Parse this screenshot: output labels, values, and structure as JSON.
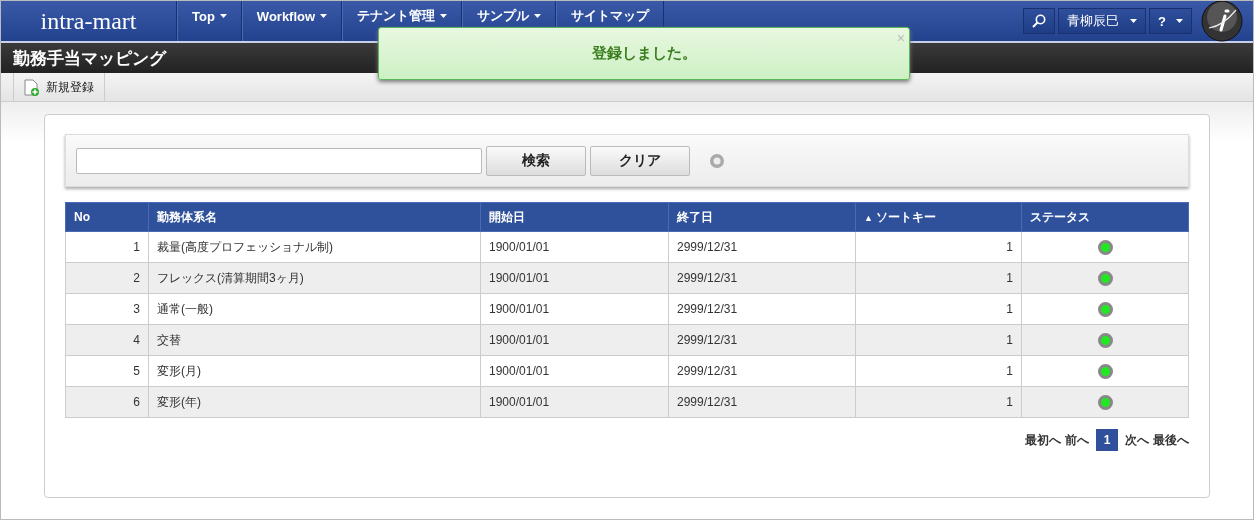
{
  "header": {
    "logo": "intra-mart",
    "nav": [
      {
        "label": "Top",
        "dropdown": true
      },
      {
        "label": "Workflow",
        "dropdown": true
      },
      {
        "label": "テナント管理",
        "dropdown": true
      },
      {
        "label": "サンプル",
        "dropdown": true
      },
      {
        "label": "サイトマップ",
        "dropdown": false
      }
    ],
    "user": "青柳辰巳",
    "help": "?"
  },
  "page_title": "勤務手当マッピング",
  "toolbar": [
    {
      "label": "新規登録"
    }
  ],
  "toast": {
    "message": "登録しました。",
    "close": "×"
  },
  "search": {
    "buttons": [
      "検索",
      "クリア"
    ]
  },
  "table": {
    "columns": [
      {
        "label": "No"
      },
      {
        "label": "勤務体系名"
      },
      {
        "label": "開始日"
      },
      {
        "label": "終了日"
      },
      {
        "label": "ソートキー",
        "sort": "▲"
      },
      {
        "label": "ステータス"
      }
    ],
    "rows": [
      {
        "no": "1",
        "name": "裁量(高度プロフェッショナル制)",
        "start": "1900/01/01",
        "end": "2999/12/31",
        "sort_key": "1",
        "color": "#22e822"
      },
      {
        "no": "2",
        "name": "フレックス(清算期間3ヶ月)",
        "start": "1900/01/01",
        "end": "2999/12/31",
        "sort_key": "1",
        "color": "#22e822"
      },
      {
        "no": "3",
        "name": "通常(一般)",
        "start": "1900/01/01",
        "end": "2999/12/31",
        "sort_key": "1",
        "color": "#22e822"
      },
      {
        "no": "4",
        "name": "交替",
        "start": "1900/01/01",
        "end": "2999/12/31",
        "sort_key": "1",
        "color": "#22e822"
      },
      {
        "no": "5",
        "name": "変形(月)",
        "start": "1900/01/01",
        "end": "2999/12/31",
        "sort_key": "1",
        "color": "#22e822"
      },
      {
        "no": "6",
        "name": "変形(年)",
        "start": "1900/01/01",
        "end": "2999/12/31",
        "sort_key": "1",
        "color": "#22e822"
      }
    ]
  },
  "pager": {
    "first": "最初へ",
    "prev": "前へ",
    "pages": [
      {
        "label": "1",
        "selected": true
      }
    ],
    "next": "次へ",
    "last": "最後へ"
  }
}
